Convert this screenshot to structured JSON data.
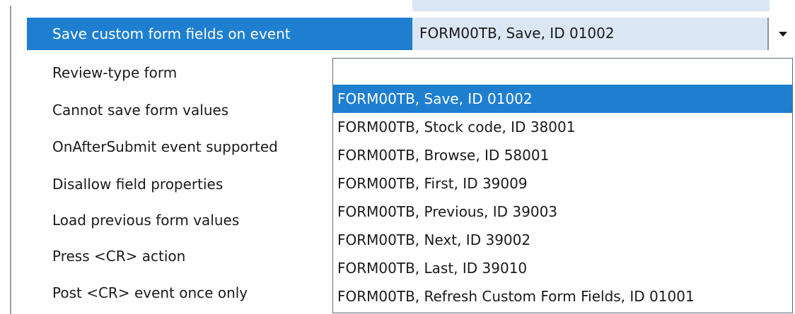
{
  "properties": [
    {
      "label": "Save custom form fields on event",
      "selected": true
    },
    {
      "label": "Review-type form"
    },
    {
      "label": "Cannot save form values"
    },
    {
      "label": "OnAfterSubmit event supported"
    },
    {
      "label": "Disallow field properties"
    },
    {
      "label": "Load previous form values"
    },
    {
      "label": "Press <CR> action"
    },
    {
      "label": "Post <CR> event once only"
    }
  ],
  "current_value": "FORM00TB, Save, ID 01002",
  "dropdown_button_icon": "chevron-down-icon",
  "dropdown_options": [
    {
      "label": "FORM00TB, Save, ID 01002",
      "selected": true
    },
    {
      "label": "FORM00TB, Stock code, ID 38001"
    },
    {
      "label": "FORM00TB, Browse, ID 58001"
    },
    {
      "label": "FORM00TB, First, ID 39009"
    },
    {
      "label": "FORM00TB, Previous, ID 39003"
    },
    {
      "label": "FORM00TB, Next, ID 39002"
    },
    {
      "label": "FORM00TB, Last, ID 39010"
    },
    {
      "label": "FORM00TB, Refresh Custom Form Fields, ID 01001"
    }
  ],
  "colors": {
    "selection": "#1e7fd0",
    "value_cell": "#dbe6f4"
  }
}
